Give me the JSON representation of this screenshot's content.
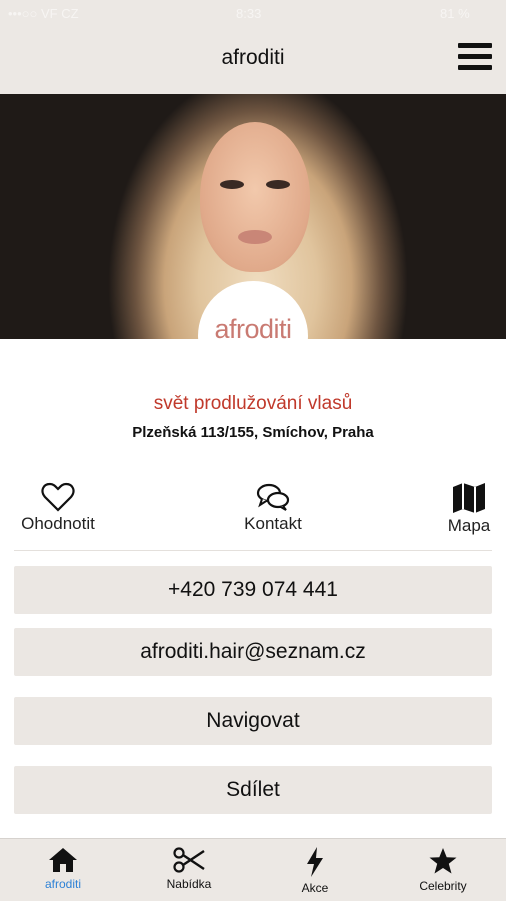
{
  "status_bar": {
    "carrier": "•••○○ VF CZ",
    "time": "8:33",
    "battery": "81 %"
  },
  "header": {
    "title": "afroditi",
    "menu_icon": "hamburger-menu-icon"
  },
  "hero": {
    "logo_text": "afroditi"
  },
  "salon": {
    "tagline": "svět prodlužování vlasů",
    "address": "Plzeňská 113/155, Smíchov, Praha"
  },
  "actions": [
    {
      "label": "Ohodnotit",
      "icon": "heart-outline-icon"
    },
    {
      "label": "Kontakt",
      "icon": "chat-bubbles-icon"
    },
    {
      "label": "Mapa",
      "icon": "map-icon"
    }
  ],
  "buttons": {
    "phone": "+420 739 074 441",
    "email": "afroditi.hair@seznam.cz",
    "navigate": "Navigovat",
    "share": "Sdílet"
  },
  "tabs": [
    {
      "label": "afroditi",
      "icon": "home-icon",
      "active": true
    },
    {
      "label": "Nabídka",
      "icon": "scissors-icon",
      "active": false
    },
    {
      "label": "Akce",
      "icon": "lightning-bolt-icon",
      "active": false
    },
    {
      "label": "Celebrity",
      "icon": "star-icon",
      "active": false
    }
  ],
  "colors": {
    "accent_red": "#c0392b",
    "active_tab": "#2e82d6",
    "button_bg": "#ebe7e3",
    "bar_bg": "#ece8e4"
  }
}
